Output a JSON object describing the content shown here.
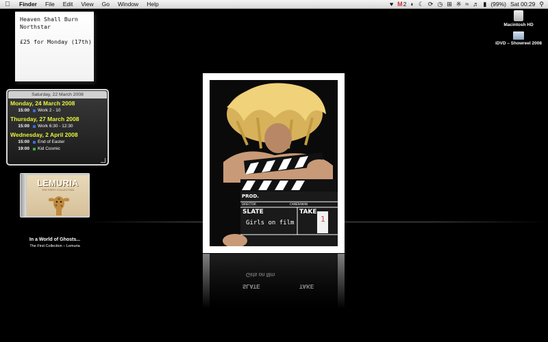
{
  "menubar": {
    "app_name": "Finder",
    "menus": [
      "File",
      "Edit",
      "View",
      "Go",
      "Window",
      "Help"
    ],
    "gmail_count": "2",
    "battery": "(99%)",
    "clock": "Sat 00:29"
  },
  "note": {
    "line1": "Heaven Shall Burn",
    "line2": "Northstar",
    "line3": "£25 for Monday (17th)"
  },
  "calendar": {
    "header": "Saturday, 22 March 2008",
    "days": [
      {
        "label": "Monday, 24 March 2008",
        "events": [
          {
            "time": "15:00",
            "title": "Work 2 - 10",
            "color": "#3a6fd8"
          }
        ]
      },
      {
        "label": "Thursday, 27 March 2008",
        "events": [
          {
            "time": "15:00",
            "title": "Work 6:30 - 12:30",
            "color": "#3a6fd8"
          }
        ]
      },
      {
        "label": "Wednesday, 2 April 2008",
        "events": [
          {
            "time": "15:00",
            "title": "End of Easter",
            "color": "#3a6fd8"
          },
          {
            "time": "19:00",
            "title": "Kid Cosmic",
            "color": "#3fae3f"
          }
        ]
      }
    ]
  },
  "album": {
    "cover_title": "LEMURIA",
    "cover_subtitle": "THE FIRST COLLECTION",
    "track": "In a World of Ghosts...",
    "artist_line": "The First Collection – Lemuria"
  },
  "desktop_icons": [
    {
      "label": "Macintosh HD",
      "icon": "hard-drive-icon"
    },
    {
      "label": "iDVD – Showreel 2008",
      "icon": "folder-icon"
    }
  ],
  "poster": {
    "prod": "PROD.",
    "director": "DIRECTOR",
    "cameraman": "CAMERAMAN",
    "slate": "SLATE",
    "take": "TAKE",
    "slate_value": "Girls on film",
    "take_value": "1"
  },
  "colors": {
    "calendar_day": "#e8f53a",
    "desktop_bg": "#000000"
  }
}
